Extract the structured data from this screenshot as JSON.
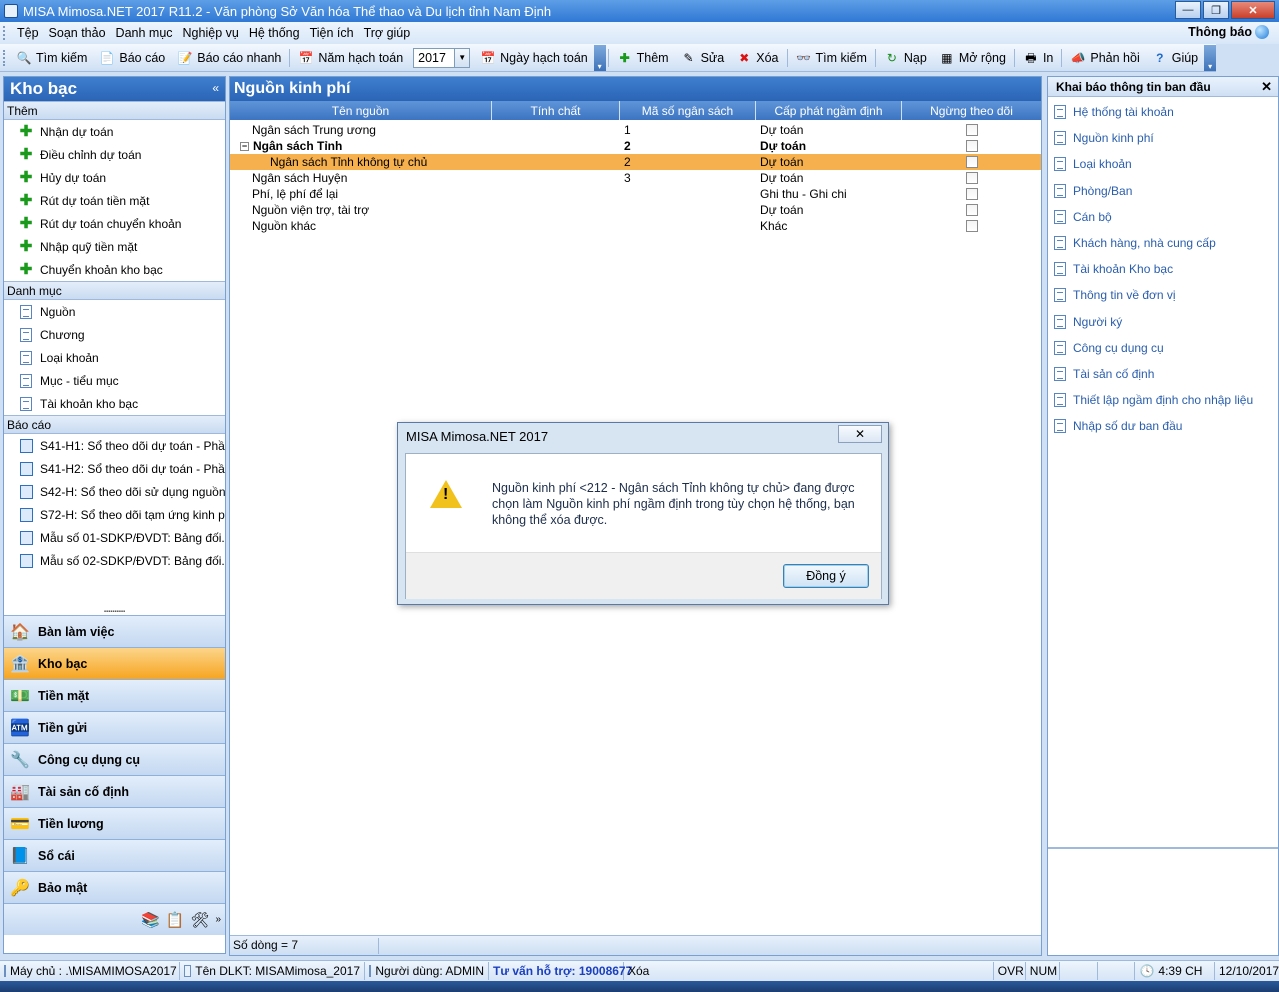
{
  "window": {
    "title": "MISA Mimosa.NET 2017 R11.2 - Văn phòng Sở Văn hóa Thể thao và Du lịch tỉnh Nam Định",
    "min_label": "—",
    "max_label": "❐",
    "close_label": "✕"
  },
  "menubar": {
    "items": [
      "Tệp",
      "Soạn thảo",
      "Danh mục",
      "Nghiệp vụ",
      "Hệ thống",
      "Tiện ích",
      "Trợ giúp"
    ],
    "notify_label": "Thông báo"
  },
  "toolbar": {
    "search": "Tìm kiếm",
    "report": "Báo cáo",
    "quick_report": "Báo cáo nhanh",
    "year_label": "Năm hạch toán",
    "year_value": "2017",
    "date_label": "Ngày hạch toán",
    "add": "Thêm",
    "edit": "Sửa",
    "delete": "Xóa",
    "find": "Tìm kiếm",
    "load": "Nạp",
    "expand": "Mở rộng",
    "print": "In",
    "feedback": "Phản hồi",
    "help": "Giúp"
  },
  "left": {
    "title": "Kho bạc",
    "collapse_label": "«",
    "sections": {
      "add": "Thêm",
      "catalog": "Danh mục",
      "report": "Báo cáo"
    },
    "add_items": [
      "Nhận dự toán",
      "Điều chỉnh dự toán",
      "Hủy dự toán",
      "Rút dự toán tiền mặt",
      "Rút dự toán chuyển khoản",
      "Nhập quỹ tiền mặt",
      "Chuyển khoản kho bạc"
    ],
    "catalog_items": [
      "Nguồn",
      "Chương",
      "Loại khoản",
      "Mục - tiểu mục",
      "Tài khoản kho bạc"
    ],
    "report_items": [
      "S41-H1: Sổ theo dõi dự toán - Phầ...",
      "S41-H2: Sổ theo dõi dự toán - Phầ...",
      "S42-H: Sổ theo dõi sử dụng nguồn...",
      "S72-H: Sổ theo dõi tạm ứng kinh p...",
      "Mẫu số 01-SDKP/ĐVDT: Bảng đối...",
      "Mẫu số 02-SDKP/ĐVDT: Bảng đối..."
    ],
    "nav": [
      "Bàn làm việc",
      "Kho bạc",
      "Tiền mặt",
      "Tiền gửi",
      "Công cụ dụng cụ",
      "Tài sản cố định",
      "Tiền lương",
      "Sổ cái",
      "Bảo mật"
    ],
    "nav_active": "Kho bạc",
    "nav_icons": [
      "🏠",
      "🏦",
      "💵",
      "🏧",
      "🔧",
      "🏭",
      "💳",
      "📘",
      "🔑"
    ]
  },
  "main": {
    "title": "Nguồn kinh phí",
    "columns": [
      "Tên nguồn",
      "Tính chất",
      "Mã số ngân sách",
      "Cấp phát ngầm định",
      "Ngừng theo dõi"
    ],
    "rows": [
      {
        "name": "Ngân sách Trung ương",
        "nature": "",
        "code": "1",
        "default": "Dự toán",
        "bold": false,
        "selected": false,
        "indent": 0,
        "toggle": ""
      },
      {
        "name": "Ngân sách Tỉnh",
        "nature": "",
        "code": "2",
        "default": "Dự toán",
        "bold": true,
        "selected": false,
        "indent": 0,
        "toggle": "−"
      },
      {
        "name": "Ngân sách Tỉnh không tự chủ",
        "nature": "",
        "code": "2",
        "default": "Dự toán",
        "bold": false,
        "selected": true,
        "indent": 1,
        "toggle": ""
      },
      {
        "name": "Ngân sách Huyện",
        "nature": "",
        "code": "3",
        "default": "Dự toán",
        "bold": false,
        "selected": false,
        "indent": 0,
        "toggle": ""
      },
      {
        "name": "Phí, lệ phí để lại",
        "nature": "",
        "code": "",
        "default": "Ghi thu - Ghi chi",
        "bold": false,
        "selected": false,
        "indent": 0,
        "toggle": ""
      },
      {
        "name": "Nguồn viện trợ, tài trợ",
        "nature": "",
        "code": "",
        "default": "Dự toán",
        "bold": false,
        "selected": false,
        "indent": 0,
        "toggle": ""
      },
      {
        "name": "Nguồn khác",
        "nature": "",
        "code": "",
        "default": "Khác",
        "bold": false,
        "selected": false,
        "indent": 0,
        "toggle": ""
      }
    ],
    "row_count": "Số dòng = 7"
  },
  "right": {
    "title": "Khai báo thông tin ban đầu",
    "close_label": "✕",
    "items": [
      "Hệ thống tài khoản",
      "Nguồn kinh phí",
      "Loại khoản",
      "Phòng/Ban",
      "Cán bộ",
      "Khách hàng, nhà cung cấp",
      "Tài khoản Kho bạc",
      "Thông tin về đơn vị",
      "Người ký",
      "Công cụ dụng cụ",
      "Tài sản cố định",
      "Thiết lập ngầm định cho nhập liệu",
      "Nhập số dư ban đầu"
    ]
  },
  "dialog": {
    "title": "MISA Mimosa.NET 2017",
    "close_label": "✕",
    "message": "Nguồn kinh phí <212 - Ngân sách Tỉnh không tự chủ> đang được chọn làm Nguồn kinh phí ngầm định trong tùy chọn hệ thống, bạn không thể xóa được.",
    "ok_label": "Đồng ý"
  },
  "status": {
    "machine": "Máy chủ : .\\MISAMIMOSA2017",
    "db": "Tên DLKT: MISAMimosa_2017",
    "user": "Người dùng: ADMIN",
    "support": "Tư vấn hỗ trợ: 19008677",
    "action": "Xóa",
    "ovr": "OVR",
    "num": "NUM",
    "time": "4:39 CH",
    "date": "12/10/2017"
  }
}
